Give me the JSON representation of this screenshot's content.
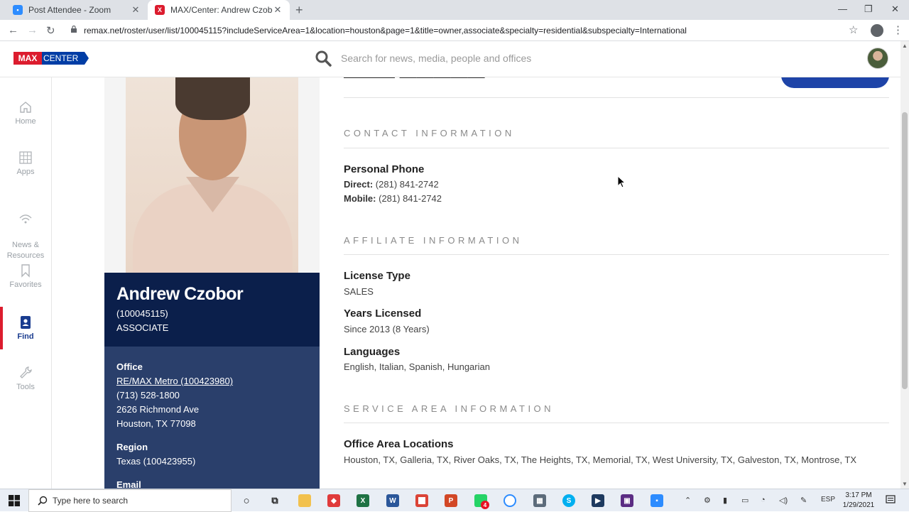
{
  "browser": {
    "tabs": [
      {
        "title": "Post Attendee - Zoom",
        "favicon_color": "#2d8cff",
        "active": false
      },
      {
        "title": "MAX/Center: Andrew Czobor",
        "favicon_color": "#dc1c2e",
        "active": true
      }
    ],
    "url": "remax.net/roster/user/list/100045115?includeServiceArea=1&location=houston&page=1&title=owner,associate&specialty=residential&subspecialty=International"
  },
  "header": {
    "logo_max": "MAX",
    "logo_center": "CENTER",
    "search_placeholder": "Search for news, media, people and offices"
  },
  "sidebar": {
    "items": [
      {
        "label": "Home",
        "icon": "home-icon",
        "active": false
      },
      {
        "label": "Apps",
        "icon": "apps-grid-icon",
        "active": false
      },
      {
        "label": "News &\nResources",
        "icon": "wifi-icon",
        "active": false
      },
      {
        "label": "Favorites",
        "icon": "bookmark-icon",
        "active": false
      },
      {
        "label": "Find",
        "icon": "contact-card-icon",
        "active": true
      },
      {
        "label": "Tools",
        "icon": "wrench-icon",
        "active": false
      }
    ]
  },
  "profile": {
    "name": "Andrew Czobor",
    "id": "(100045115)",
    "role": "ASSOCIATE",
    "office_label": "Office",
    "office_name": "RE/MAX Metro (100423980)",
    "office_phone": "(713) 528-1800",
    "office_street": "2626 Richmond Ave",
    "office_city": "Houston, TX 77098",
    "region_label": "Region",
    "region_value": "Texas (100423955)",
    "email_label": "Email"
  },
  "contact": {
    "section_title": "CONTACT INFORMATION",
    "personal_phone_label": "Personal Phone",
    "direct_label": "Direct:",
    "direct_value": " (281) 841-2742",
    "mobile_label": "Mobile:",
    "mobile_value": " (281) 841-2742"
  },
  "affiliate": {
    "section_title": "AFFILIATE INFORMATION",
    "license_type_label": "License Type",
    "license_type_value": "SALES",
    "years_licensed_label": "Years Licensed",
    "years_licensed_value": "Since 2013 (8 Years)",
    "languages_label": "Languages",
    "languages_value": "English, Italian, Spanish, Hungarian"
  },
  "service_area": {
    "section_title": "SERVICE AREA INFORMATION",
    "office_area_label": "Office Area Locations",
    "office_area_value": "Houston, TX, Galleria, TX, River Oaks, TX, The Heights, TX, Memorial, TX, West University, TX, Galveston, TX, Montrose, TX"
  },
  "taskbar": {
    "search_text": "Type here to search",
    "language": "ESP",
    "time": "3:17 PM",
    "date": "1/29/2021",
    "whatsapp_badge": "4"
  },
  "colors": {
    "remax_red": "#dc1c2e",
    "remax_blue": "#003da5",
    "name_panel": "#0b1f4b",
    "office_panel": "#2a3f6b"
  }
}
